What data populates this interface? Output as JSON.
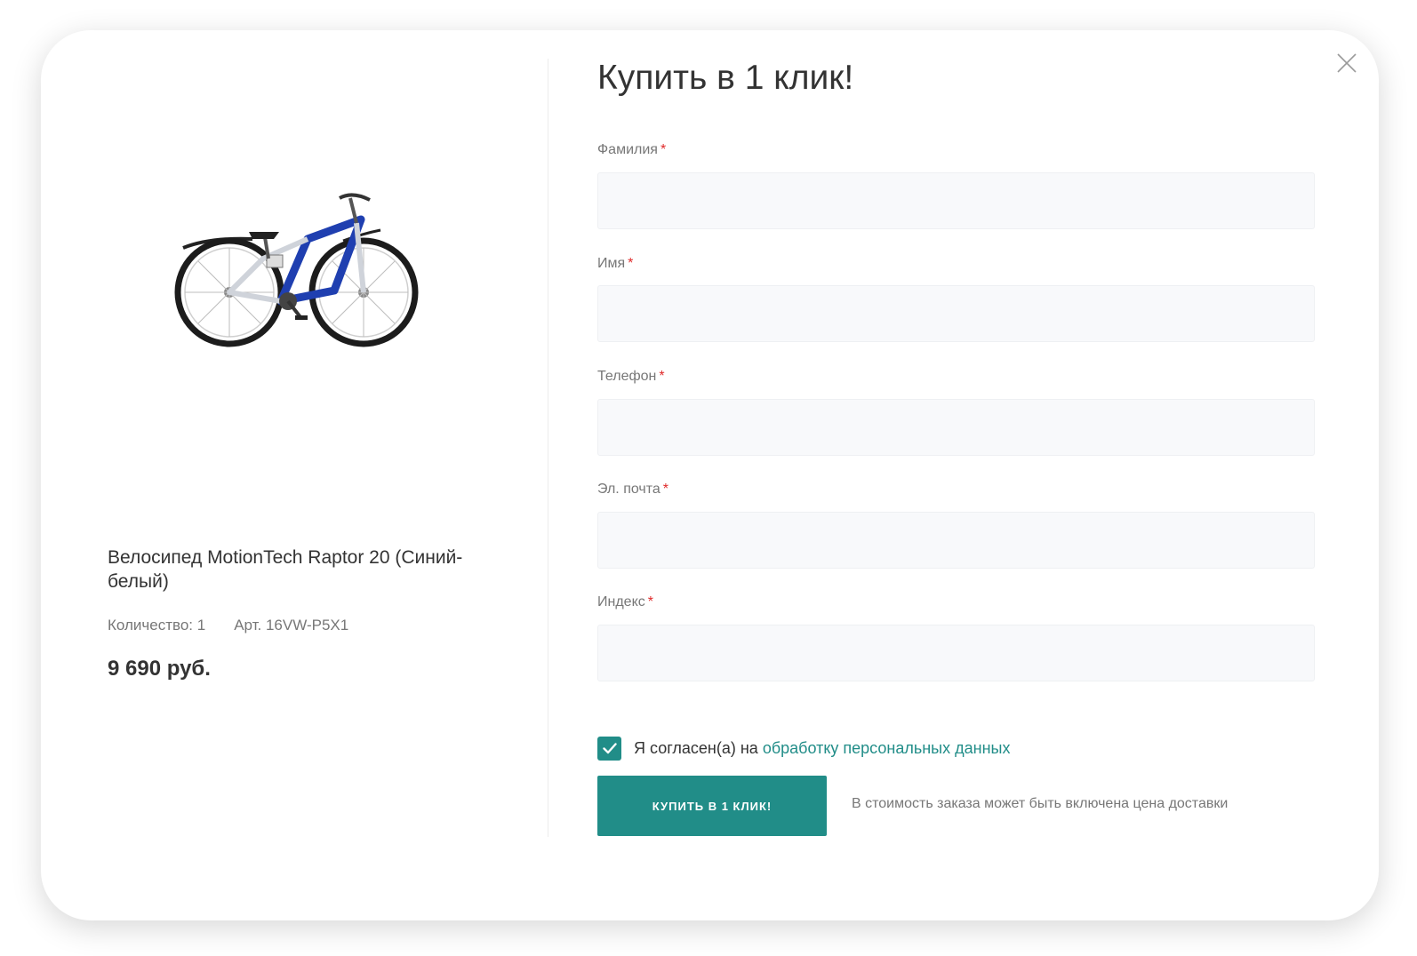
{
  "product": {
    "title": "Велосипед MotionTech Raptor 20 (Синий-белый)",
    "quantity": "Количество: 1",
    "article": "Арт. 16VW-P5X1",
    "price": "9 690 руб."
  },
  "form": {
    "title": "Купить в 1 клик!",
    "required_mark": "*",
    "fields": [
      {
        "label": "Фамилия",
        "value": ""
      },
      {
        "label": "Имя",
        "value": ""
      },
      {
        "label": "Телефон",
        "value": ""
      },
      {
        "label": "Эл. почта",
        "value": ""
      },
      {
        "label": "Индекс",
        "value": ""
      }
    ],
    "consent": {
      "checked": true,
      "text": "Я согласен(а) на",
      "link": "обработку персональных данных"
    },
    "submit_label": "Купить в 1 клик!",
    "delivery_note": "В стоимость заказа может быть включена цена доставки"
  },
  "colors": {
    "accent": "#218d88",
    "required": "#e02a2a",
    "bike_frame": "#1f3fb0"
  },
  "icons": {
    "close": "close-icon",
    "checkbox": "check-icon"
  }
}
